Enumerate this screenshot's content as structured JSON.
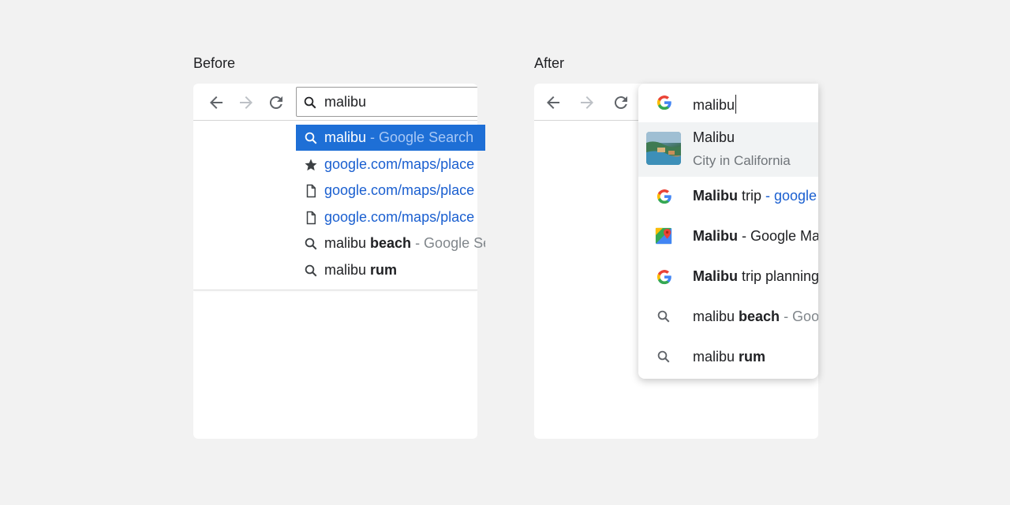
{
  "before": {
    "label": "Before",
    "omnibox_value": "malibu",
    "suggestions": [
      {
        "icon": "search-icon",
        "text": "malibu",
        "sub": " - Google Search",
        "selected": true
      },
      {
        "icon": "star-icon",
        "link": "google.com/maps/place"
      },
      {
        "icon": "page-icon",
        "link": "google.com/maps/place"
      },
      {
        "icon": "page-icon",
        "link": "google.com/maps/place"
      },
      {
        "icon": "search-icon",
        "text": "malibu ",
        "bold": "beach",
        "sub": " - Google Search"
      },
      {
        "icon": "search-icon",
        "text": "malibu ",
        "bold": "rum"
      }
    ]
  },
  "after": {
    "label": "After",
    "omnibox_value": "malibu",
    "entity": {
      "title": "Malibu",
      "subtitle": "City in California"
    },
    "suggestions": [
      {
        "icon": "google-icon",
        "bold": "Malibu",
        "text": " trip",
        "sub": "  - google"
      },
      {
        "icon": "maps-icon",
        "bold": "Malibu",
        "text": " - Google Maps"
      },
      {
        "icon": "google-icon",
        "bold": "Malibu",
        "text": " trip planning"
      },
      {
        "icon": "search-icon",
        "text": "malibu ",
        "bold": "beach",
        "sub": " - Google Search"
      },
      {
        "icon": "search-icon",
        "text": "malibu ",
        "bold": "rum"
      }
    ]
  },
  "colors": {
    "selection": "#1e6fd6",
    "link": "#1a5fd0",
    "background": "#f2f2f2"
  }
}
